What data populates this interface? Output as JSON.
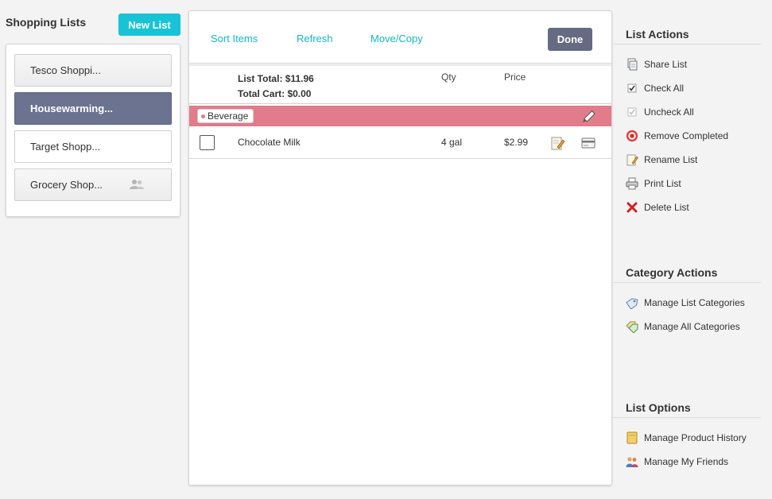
{
  "sidebar": {
    "title": "Shopping Lists",
    "new_list_label": "New List",
    "lists": [
      {
        "label": "Tesco Shoppi..."
      },
      {
        "label": "Housewarming..."
      },
      {
        "label": "Target Shopp..."
      },
      {
        "label": "Grocery Shop..."
      }
    ]
  },
  "toolbar": {
    "sort_label": "Sort Items",
    "refresh_label": "Refresh",
    "move_copy_label": "Move/Copy",
    "done_label": "Done"
  },
  "summary": {
    "list_total": "List Total: $11.96",
    "total_cart": "Total Cart: $0.00",
    "qty_header": "Qty",
    "price_header": "Price"
  },
  "category": {
    "name": "Beverage"
  },
  "items": [
    {
      "name": "Chocolate Milk",
      "qty": "4 gal",
      "price": "$2.99"
    }
  ],
  "list_actions": {
    "title": "List Actions",
    "items": [
      {
        "label": "Share List",
        "icon": "share-icon"
      },
      {
        "label": "Check All",
        "icon": "check-all-icon"
      },
      {
        "label": "Uncheck All",
        "icon": "uncheck-all-icon"
      },
      {
        "label": "Remove Completed",
        "icon": "target-icon"
      },
      {
        "label": "Rename List",
        "icon": "pencil-note-icon"
      },
      {
        "label": "Print List",
        "icon": "printer-icon"
      },
      {
        "label": "Delete List",
        "icon": "red-x-icon"
      }
    ]
  },
  "category_actions": {
    "title": "Category Actions",
    "items": [
      {
        "label": "Manage List Categories",
        "icon": "tag-icon"
      },
      {
        "label": "Manage All Categories",
        "icon": "tags-icon"
      }
    ]
  },
  "list_options": {
    "title": "List Options",
    "items": [
      {
        "label": "Manage Product History",
        "icon": "folder-icon"
      },
      {
        "label": "Manage My Friends",
        "icon": "friends-icon"
      }
    ]
  },
  "colors": {
    "accent": "#19c3d6",
    "active_list": "#6c7390",
    "category_bar": "#e27b8a",
    "done_button": "#656b82"
  }
}
